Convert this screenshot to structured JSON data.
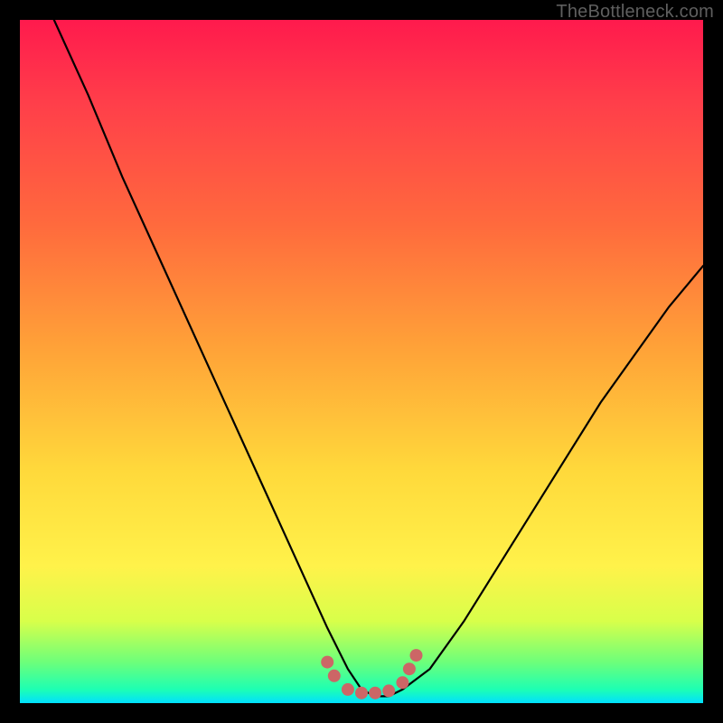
{
  "watermark": "TheBottleneck.com",
  "chart_data": {
    "type": "line",
    "title": "",
    "xlabel": "",
    "ylabel": "",
    "xlim": [
      0,
      100
    ],
    "ylim": [
      0,
      100
    ],
    "series": [
      {
        "name": "bottleneck-curve",
        "x": [
          5,
          10,
          15,
          20,
          25,
          30,
          35,
          40,
          45,
          48,
          50,
          52,
          54,
          56,
          60,
          65,
          70,
          75,
          80,
          85,
          90,
          95,
          100
        ],
        "values": [
          100,
          89,
          77,
          66,
          55,
          44,
          33,
          22,
          11,
          5,
          2,
          1,
          1,
          2,
          5,
          12,
          20,
          28,
          36,
          44,
          51,
          58,
          64
        ]
      }
    ],
    "markers": {
      "name": "highlight-dots",
      "color": "#cc6666",
      "x": [
        45,
        46,
        48,
        50,
        52,
        54,
        56,
        57,
        58
      ],
      "values": [
        6,
        4,
        2,
        1.5,
        1.5,
        1.8,
        3,
        5,
        7
      ]
    },
    "gradient_stops": [
      {
        "pos": 0,
        "color": "#ff1a4d"
      },
      {
        "pos": 30,
        "color": "#ff6a3d"
      },
      {
        "pos": 66,
        "color": "#ffd93b"
      },
      {
        "pos": 94,
        "color": "#6dff7a"
      },
      {
        "pos": 100,
        "color": "#00e0ff"
      }
    ]
  }
}
